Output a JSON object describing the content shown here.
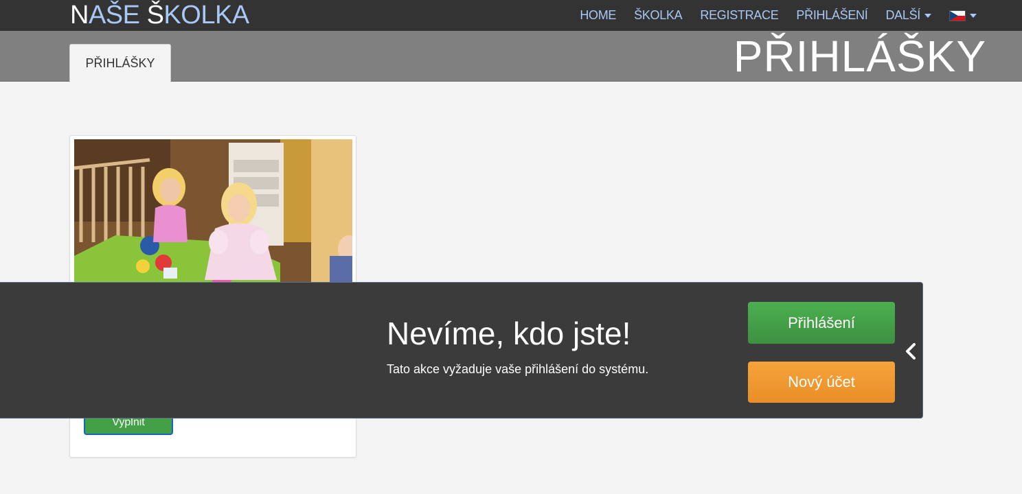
{
  "brand": {
    "part1": "N",
    "part2": "AŠE ",
    "part3": "Š",
    "part4": "KOLKA"
  },
  "nav": {
    "items": [
      {
        "label": "HOME"
      },
      {
        "label": "ŠKOLKA"
      },
      {
        "label": "REGISTRACE"
      },
      {
        "label": "PŘIHLÁŠENÍ"
      },
      {
        "label": "DALŠÍ"
      }
    ],
    "language_icon": "czech-flag-icon"
  },
  "tabs": [
    {
      "label": "PŘIHLÁŠKY"
    }
  ],
  "page_heading": "PŘIHLÁŠKY",
  "card": {
    "image_icon": "children-photo",
    "button_label": "Vyplnit"
  },
  "auth_overlay": {
    "title": "Nevíme, kdo jste!",
    "message": "Tato akce vyžaduje vaše přihlášení do systému.",
    "login_label": "Přihlášení",
    "new_account_label": "Nový účet",
    "collapse_icon": "chevron-left-icon"
  },
  "colors": {
    "topbar": "#333333",
    "nav_link": "#a9c8f5",
    "subbar": "#808080",
    "overlay": "#3b3b3b",
    "login_button": "#43a047",
    "new_account_button": "#f0982f"
  }
}
